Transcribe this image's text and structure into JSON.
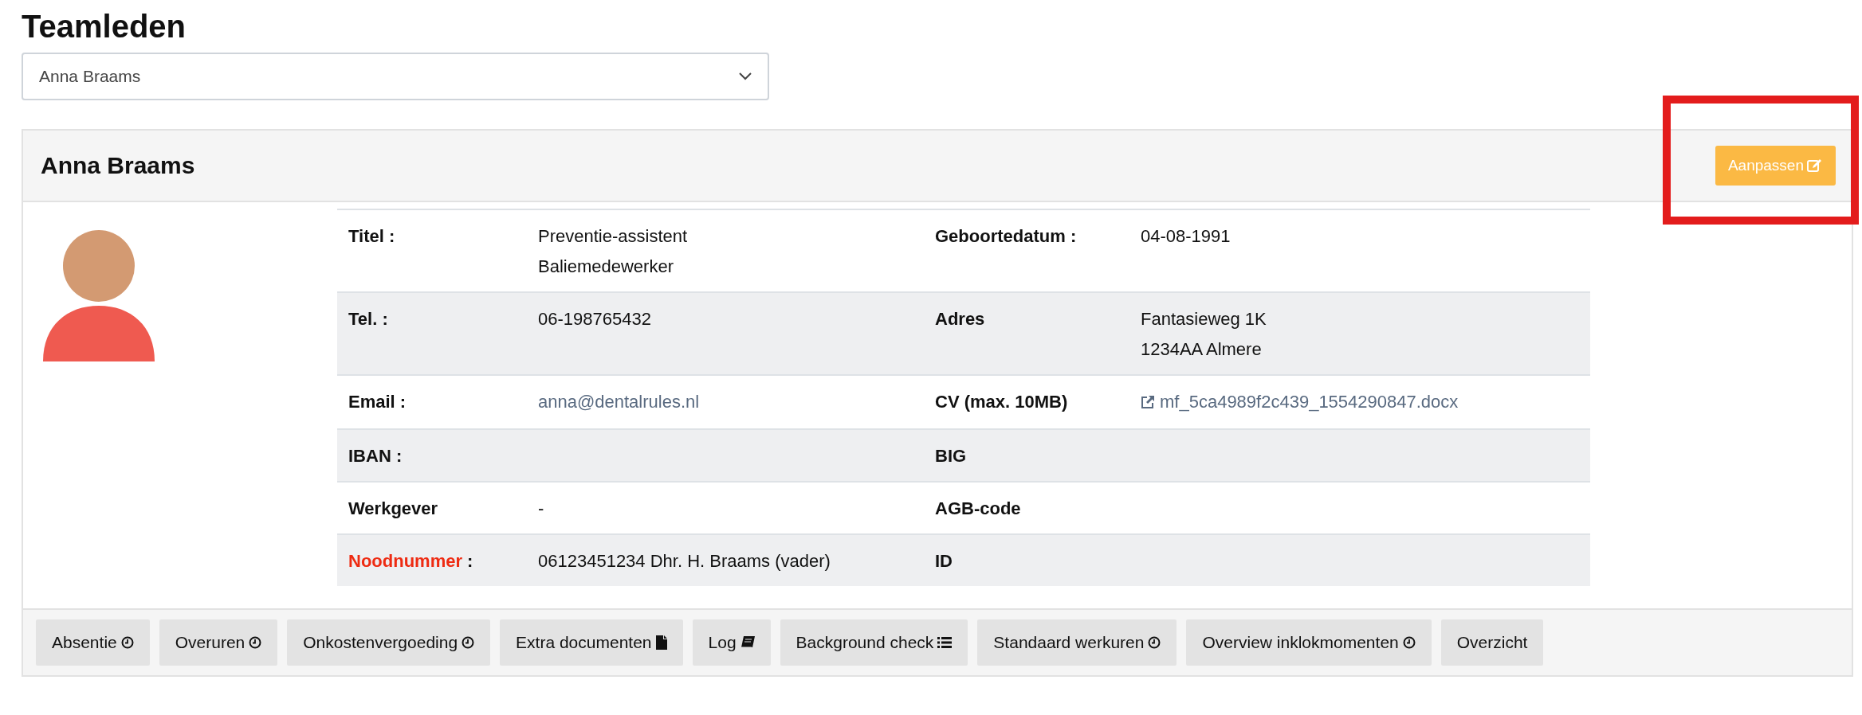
{
  "page_title": "Teamleden",
  "member_select": {
    "value": "Anna Braams"
  },
  "card": {
    "title": "Anna Braams",
    "edit_button": "Aanpassen",
    "highlighted": true,
    "rows": [
      {
        "cells": [
          {
            "label": "Titel :",
            "value": [
              "Preventie-assistent",
              "Baliemedewerker"
            ]
          },
          {
            "label": "Geboortedatum :",
            "value": [
              "04-08-1991"
            ]
          }
        ]
      },
      {
        "cells": [
          {
            "label": "Tel. :",
            "value": [
              "06-198765432"
            ]
          },
          {
            "label": "Adres",
            "value": [
              "Fantasieweg 1K",
              "1234AA Almere"
            ]
          }
        ]
      },
      {
        "cells": [
          {
            "label": "Email :",
            "value": [
              "anna@dentalrules.nl"
            ],
            "kind": "link"
          },
          {
            "label": "CV (max. 10MB)",
            "value": [
              "mf_5ca4989f2c439_1554290847.docx"
            ],
            "kind": "file"
          }
        ]
      },
      {
        "cells": [
          {
            "label": "IBAN :"
          },
          {
            "label": "BIG"
          }
        ]
      },
      {
        "cells": [
          {
            "label": "Werkgever",
            "value": [
              "-"
            ]
          },
          {
            "label": "AGB-code"
          }
        ]
      },
      {
        "cells": [
          {
            "label": "Noodnummer",
            "label_suffix": " :",
            "alert": true,
            "value": [
              "06123451234 Dhr. H. Braams (vader)"
            ]
          },
          {
            "label": "ID"
          }
        ]
      }
    ],
    "footer_buttons": [
      {
        "label": "Absentie",
        "kind": "clock"
      },
      {
        "label": "Overuren",
        "kind": "clock"
      },
      {
        "label": "Onkostenvergoeding",
        "kind": "clock"
      },
      {
        "label": "Extra documenten",
        "kind": "document"
      },
      {
        "label": "Log",
        "kind": "book"
      },
      {
        "label": "Background check",
        "kind": "list"
      },
      {
        "label": "Standaard werkuren",
        "kind": "clock"
      },
      {
        "label": "Overview inklokmomenten",
        "kind": "clock"
      },
      {
        "label": "Overzicht",
        "kind": "plain"
      }
    ]
  }
}
